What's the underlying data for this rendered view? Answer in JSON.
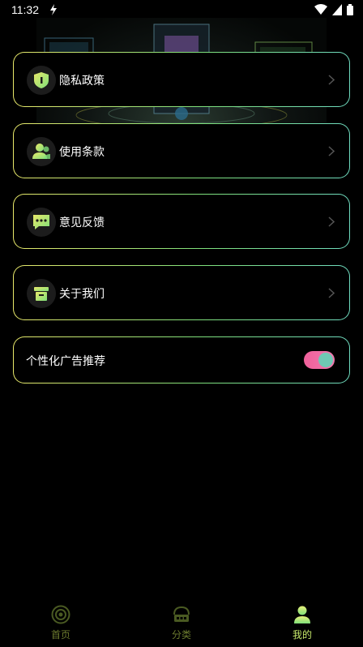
{
  "status_bar": {
    "time": "11:32"
  },
  "menu": [
    {
      "label": "隐私政策",
      "icon": "shield-icon"
    },
    {
      "label": "使用条款",
      "icon": "users-icon"
    },
    {
      "label": "意见反馈",
      "icon": "chat-icon"
    },
    {
      "label": "关于我们",
      "icon": "box-icon"
    }
  ],
  "toggle_row": {
    "label": "个性化广告推荐",
    "state": "on"
  },
  "tabs": [
    {
      "label": "首页",
      "icon": "home-icon",
      "active": false
    },
    {
      "label": "分类",
      "icon": "category-icon",
      "active": false
    },
    {
      "label": "我的",
      "icon": "profile-icon",
      "active": true
    }
  ],
  "colors": {
    "accent_yellow": "#e8e86a",
    "accent_green": "#7fe07a",
    "accent_teal": "#6fdcc0",
    "toggle_pink": "#f0609a",
    "tab_active": "#c6e86a",
    "tab_inactive": "#6b7a2e"
  }
}
